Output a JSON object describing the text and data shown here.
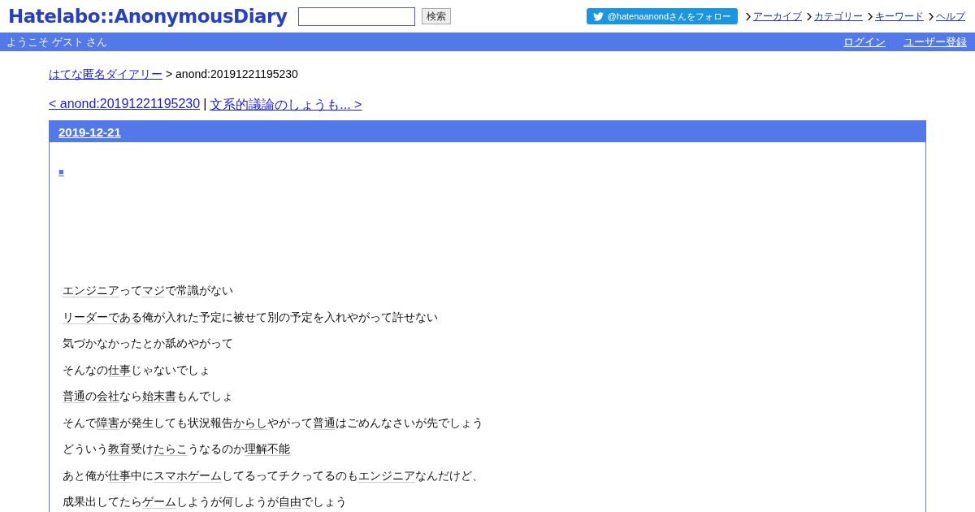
{
  "header": {
    "logo": "Hatelabo::AnonymousDiary",
    "search": {
      "button": "検索"
    },
    "follow_button": "@hatenaanondさんをフォロー",
    "nav_links": [
      "アーカイブ",
      "カテゴリー",
      "キーワード",
      "ヘルプ"
    ]
  },
  "welcome_bar": {
    "greeting": "ようこそ ゲスト さん",
    "links": [
      "ログイン",
      "ユーザー登録"
    ]
  },
  "breadcrumb": {
    "link": "はてな匿名ダイアリー",
    "current": "> anond:20191221195230"
  },
  "pager": {
    "prev": "< anond:20191221195230",
    "separator": "|",
    "next": "文系的議論のしょうも... >"
  },
  "entry": {
    "date": "2019-12-21",
    "anchor": "■",
    "paragraphs": [
      {
        "segments": [
          {
            "text": "エンジニア",
            "keyword": true
          },
          {
            "text": "って",
            "keyword": false
          },
          {
            "text": "マジ",
            "keyword": true
          },
          {
            "text": "で",
            "keyword": false
          },
          {
            "text": "常識",
            "keyword": true
          },
          {
            "text": "がない",
            "keyword": false
          }
        ]
      },
      {
        "segments": [
          {
            "text": "リーダー",
            "keyword": true
          },
          {
            "text": "である",
            "keyword": true
          },
          {
            "text": "俺が入れた予定に被せて別の予定を入れやがって許せない",
            "keyword": false
          }
        ]
      },
      {
        "segments": [
          {
            "text": "気づかなかったとか舐めやがって",
            "keyword": false
          }
        ]
      },
      {
        "segments": [
          {
            "text": "そんなの",
            "keyword": false
          },
          {
            "text": "仕事",
            "keyword": true
          },
          {
            "text": "じゃないでしょ",
            "keyword": false
          }
        ]
      },
      {
        "segments": [
          {
            "text": "普通",
            "keyword": true
          },
          {
            "text": "の",
            "keyword": false
          },
          {
            "text": "会社",
            "keyword": true
          },
          {
            "text": "なら",
            "keyword": false
          },
          {
            "text": "始末書",
            "keyword": true
          },
          {
            "text": "もんでしょ",
            "keyword": false
          }
        ]
      },
      {
        "segments": [
          {
            "text": "そんで",
            "keyword": false
          },
          {
            "text": "障害",
            "keyword": true
          },
          {
            "text": "が発生しても状況報告",
            "keyword": false
          },
          {
            "text": "からし",
            "keyword": true
          },
          {
            "text": "やがって",
            "keyword": false
          },
          {
            "text": "普通",
            "keyword": true
          },
          {
            "text": "はごめんなさいが先でしょう",
            "keyword": false
          }
        ]
      },
      {
        "segments": [
          {
            "text": "どういう",
            "keyword": false
          },
          {
            "text": "教育",
            "keyword": true
          },
          {
            "text": "受け",
            "keyword": false
          },
          {
            "text": "たらこ",
            "keyword": true
          },
          {
            "text": "うなるのか",
            "keyword": false
          },
          {
            "text": "理解不能",
            "keyword": true
          }
        ]
      },
      {
        "segments": [
          {
            "text": "あと俺が",
            "keyword": false
          },
          {
            "text": "仕事",
            "keyword": true
          },
          {
            "text": "中に",
            "keyword": false
          },
          {
            "text": "スマホゲーム",
            "keyword": true
          },
          {
            "text": "してるってチクってるのも",
            "keyword": false
          },
          {
            "text": "エンジニア",
            "keyword": true
          },
          {
            "text": "なんだけど、",
            "keyword": false
          }
        ]
      },
      {
        "segments": [
          {
            "text": "成果出してたら",
            "keyword": false
          },
          {
            "text": "ゲーム",
            "keyword": true
          },
          {
            "text": "しようが何しようが",
            "keyword": false
          },
          {
            "text": "自由",
            "keyword": true
          },
          {
            "text": "でしょう",
            "keyword": false
          }
        ]
      }
    ]
  }
}
